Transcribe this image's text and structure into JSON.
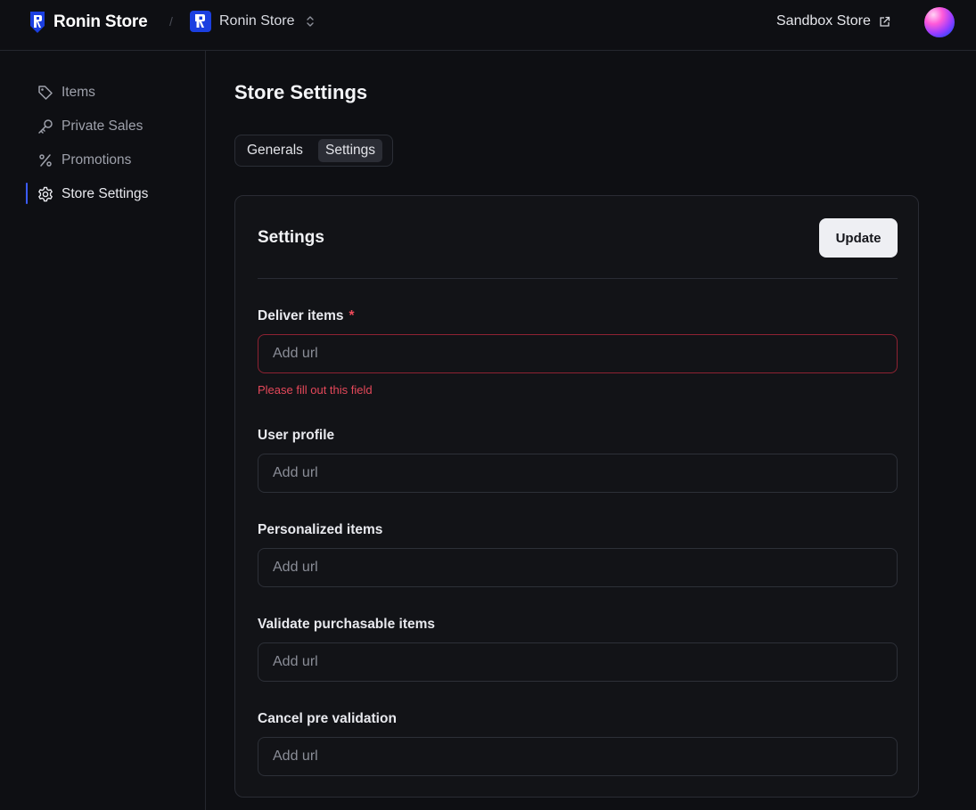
{
  "header": {
    "brand_name": "Ronin Store",
    "breadcrumb_separator": "/",
    "store_name": "Ronin Store",
    "sandbox_label": "Sandbox Store"
  },
  "sidebar": {
    "items": [
      {
        "label": "Items",
        "icon": "tag-icon"
      },
      {
        "label": "Private Sales",
        "icon": "key-icon"
      },
      {
        "label": "Promotions",
        "icon": "percent-icon"
      },
      {
        "label": "Store Settings",
        "icon": "gear-icon",
        "active": true
      }
    ]
  },
  "main": {
    "page_title": "Store Settings",
    "tabs": [
      {
        "label": "Generals"
      },
      {
        "label": "Settings",
        "selected": true
      }
    ],
    "card": {
      "title": "Settings",
      "update_label": "Update",
      "required_marker": "*",
      "fields": [
        {
          "label": "Deliver items",
          "required": true,
          "placeholder": "Add url",
          "error": "Please fill out this field"
        },
        {
          "label": "User profile",
          "placeholder": "Add url"
        },
        {
          "label": "Personalized items",
          "placeholder": "Add url"
        },
        {
          "label": "Validate purchasable items",
          "placeholder": "Add url"
        },
        {
          "label": "Cancel pre validation",
          "placeholder": "Add url"
        }
      ]
    }
  },
  "colors": {
    "background": "#0e0f13",
    "accent": "#3b5cff",
    "error": "#e5485a",
    "brand_blue": "#1b3fe0"
  }
}
